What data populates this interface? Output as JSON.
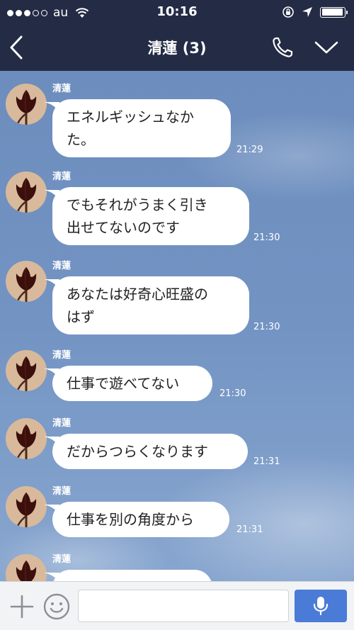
{
  "status_bar": {
    "carrier": "au",
    "time": "10:16",
    "signal_dots_filled": 3,
    "signal_dots_total": 5,
    "battery_level": 0.95
  },
  "header": {
    "title": "清蓮 (3)",
    "back_icon": "chevron-left-icon",
    "call_icon": "phone-icon",
    "menu_icon": "chevron-down-icon"
  },
  "messages": [
    {
      "sender": "清蓮",
      "text": "エネルギッシュなか\nた。",
      "time": "21:29"
    },
    {
      "sender": "清蓮",
      "text": "でもそれがうまく引き\n出せてないのです",
      "time": "21:30"
    },
    {
      "sender": "清蓮",
      "text": "あなたは好奇心旺盛の\nはず",
      "time": "21:30"
    },
    {
      "sender": "清蓮",
      "text": "仕事で遊べてない",
      "time": "21:30"
    },
    {
      "sender": "清蓮",
      "text": "だからつらくなります",
      "time": "21:31"
    },
    {
      "sender": "清蓮",
      "text": "仕事を別の角度から",
      "time": "21:31"
    },
    {
      "sender": "清蓮",
      "text": "",
      "time": ""
    }
  ],
  "input_bar": {
    "placeholder": "",
    "plus_icon": "plus-icon",
    "emoji_icon": "smiley-icon",
    "mic_icon": "microphone-icon"
  },
  "colors": {
    "header_bg": "#232b45",
    "send_button": "#4a7bd6",
    "bubble_bg": "#ffffff"
  }
}
